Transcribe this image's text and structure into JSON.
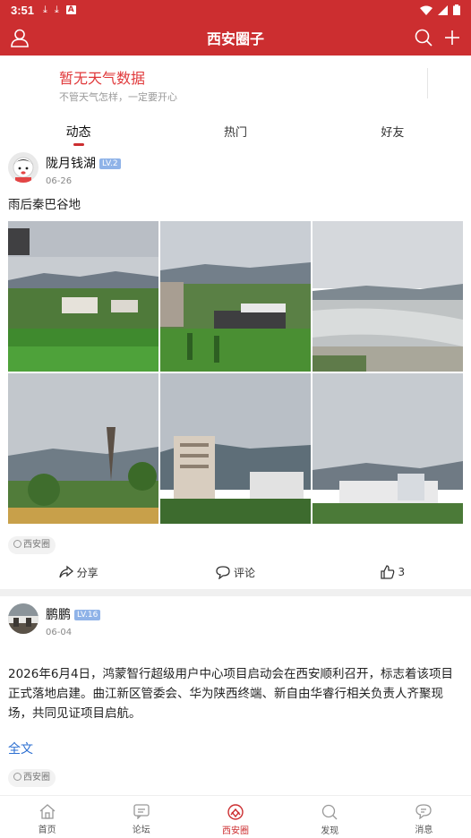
{
  "status_bar": {
    "time": "3:51",
    "icons": [
      "download-icon",
      "download-icon",
      "a-notification-icon",
      "wifi-icon",
      "signal-icon",
      "battery-icon"
    ]
  },
  "app_bar": {
    "title": "西安圈子",
    "left_icon": "user-icon",
    "right_icons": [
      "search-icon",
      "plus-icon"
    ],
    "color": "#cc2e30"
  },
  "weather": {
    "main": "暂无天气数据",
    "sub": "不管天气怎样，一定要开心"
  },
  "tabs": [
    {
      "label": "动态",
      "active": true
    },
    {
      "label": "热门",
      "active": false
    },
    {
      "label": "好友",
      "active": false
    }
  ],
  "posts": [
    {
      "user": "陇月钱湖",
      "level": "LV.2",
      "date": "06-26",
      "text": "雨后秦巴谷地",
      "photo_count": 6,
      "tag": "西安圈",
      "actions": {
        "share": "分享",
        "comment": "评论",
        "like": "3"
      }
    },
    {
      "user": "鹏鹏",
      "level": "LV.16",
      "date": "06-04",
      "text": "2026年6月4日，鸿蒙智行超级用户中心项目启动会在西安顺利召开，标志着该项目正式落地启建。曲江新区管委会、华为陕西终端、新自由华睿行相关负责人齐聚现场，共同见证项目启航。",
      "read_more": "全文",
      "tag": "西安圈"
    }
  ],
  "bottom_nav": [
    {
      "label": "首页",
      "icon": "home-icon",
      "active": false
    },
    {
      "label": "论坛",
      "icon": "forum-icon",
      "active": false
    },
    {
      "label": "西安圈",
      "icon": "xian-circle-icon",
      "active": true
    },
    {
      "label": "发现",
      "icon": "discover-icon",
      "active": false
    },
    {
      "label": "消息",
      "icon": "message-icon",
      "active": false
    }
  ]
}
